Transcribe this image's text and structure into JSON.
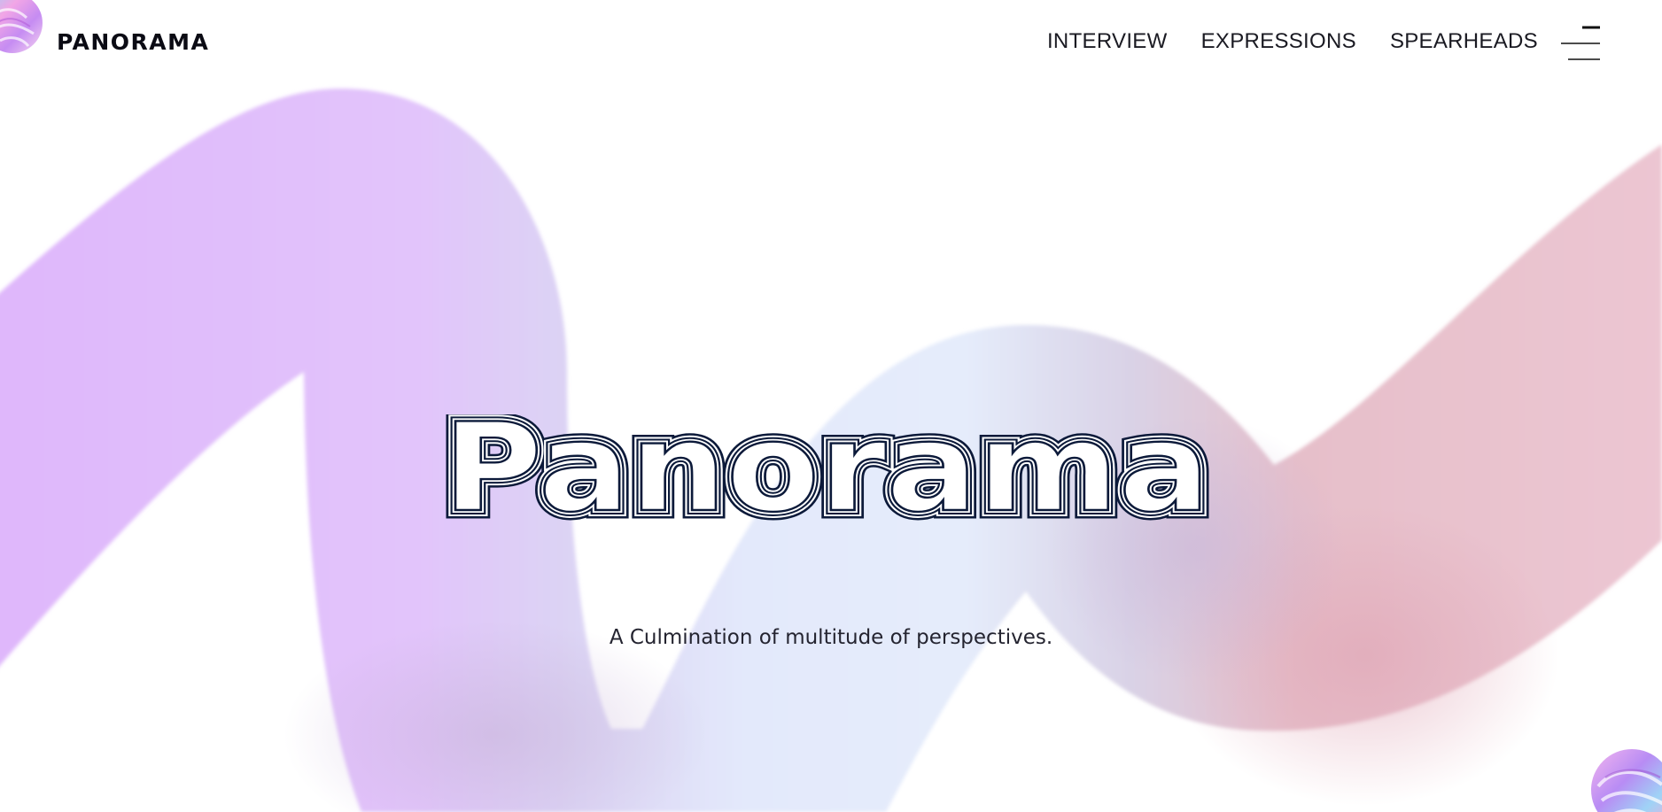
{
  "header": {
    "brand": "PANORAMA",
    "nav": [
      {
        "label": "INTERVIEW"
      },
      {
        "label": "EXPRESSIONS"
      },
      {
        "label": "SPEARHEADS"
      }
    ],
    "menu_icon": "hamburger-menu-icon"
  },
  "hero": {
    "title": "Panorama",
    "tagline": "A Culmination of multitude of perspectives."
  },
  "colors": {
    "ribbon_purple": "#e2c2fb",
    "ribbon_blue": "#e5edfb",
    "ribbon_pink": "#e9c3cc",
    "title_navy": "#0c1a3a",
    "text_dark": "#242430"
  },
  "decorations": {
    "top_left": "holographic-blob-icon",
    "bottom_right": "holographic-blob-icon"
  }
}
